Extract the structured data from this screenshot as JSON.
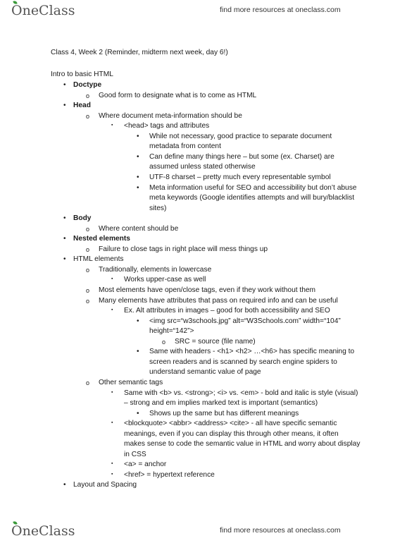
{
  "header": {
    "logo_text": "OneClass",
    "tagline": "find more resources at oneclass.com"
  },
  "footer": {
    "logo_text": "OneClass",
    "tagline": "find more resources at oneclass.com"
  },
  "document": {
    "title": "Class 4, Week 2 (Reminder, midterm next week, day 6!)",
    "section": "Intro to basic HTML",
    "lines": [
      {
        "level": 1,
        "bold": true,
        "text": "Doctype"
      },
      {
        "level": 2,
        "text": "Good form to designate what is to come as HTML"
      },
      {
        "level": 1,
        "bold": true,
        "text": "Head"
      },
      {
        "level": 2,
        "text": "Where document meta-information should be"
      },
      {
        "level": 3,
        "text": "<head> tags and attributes"
      },
      {
        "level": 4,
        "text": "While not necessary, good practice to separate document"
      },
      {
        "level": 4,
        "cont": true,
        "text": "metadata from content"
      },
      {
        "level": 4,
        "text": "Can define many things here – but some (ex. Charset) are"
      },
      {
        "level": 4,
        "cont": true,
        "text": "assumed unless stated otherwise"
      },
      {
        "level": 4,
        "text": "UTF-8 charset – pretty much every representable symbol"
      },
      {
        "level": 4,
        "text": "Meta information useful for SEO and accessibility but don’t abuse"
      },
      {
        "level": 4,
        "cont": true,
        "text": "meta keywords (Google identifies attempts and will bury/blacklist"
      },
      {
        "level": 4,
        "cont": true,
        "text": "sites)"
      },
      {
        "level": 1,
        "bold": true,
        "text": "Body"
      },
      {
        "level": 2,
        "text": "Where content should be"
      },
      {
        "level": 1,
        "bold": true,
        "text": "Nested elements"
      },
      {
        "level": 2,
        "text": "Failure to close tags in right place will mess things up"
      },
      {
        "level": 1,
        "text": "HTML elements"
      },
      {
        "level": 2,
        "text": "Traditionally, elements in lowercase"
      },
      {
        "level": 3,
        "text": "Works upper-case as well"
      },
      {
        "level": 2,
        "text": "Most elements have open/close tags, even if they work without them"
      },
      {
        "level": 2,
        "text": "Many elements have attributes that pass on required info and can be useful"
      },
      {
        "level": 3,
        "text": "Ex. Alt attributes in images – good for both accessibility and SEO"
      },
      {
        "level": 4,
        "text": "<img src=“w3schools.jpg” alt=“W3Schools.com” width=“104”"
      },
      {
        "level": 4,
        "cont": true,
        "text": "height=“142”>"
      },
      {
        "level": 5,
        "text": "SRC = source (file name)"
      },
      {
        "level": 4,
        "text": "Same with headers - <h1> <h2> …<h6> has specific meaning to"
      },
      {
        "level": 4,
        "cont": true,
        "text": "screen readers and is scanned by search engine spiders to"
      },
      {
        "level": 4,
        "cont": true,
        "text": "understand semantic value of page"
      },
      {
        "level": 2,
        "text": "Other semantic tags"
      },
      {
        "level": 3,
        "text": "Same with <b> vs. <strong>; <i> vs. <em> - bold and italic is style (visual)"
      },
      {
        "level": 3,
        "cont": true,
        "text": "– strong and em implies marked text is important (semantics)"
      },
      {
        "level": 4,
        "text": "Shows up the same but has different meanings"
      },
      {
        "level": 3,
        "text": "<blockquote> <abbr> <address> <cite> - all have specific semantic"
      },
      {
        "level": 3,
        "cont": true,
        "text": "meanings, even if you can display this through other means, it often"
      },
      {
        "level": 3,
        "cont": true,
        "text": "makes sense to code the semantic value in HTML and worry about display"
      },
      {
        "level": 3,
        "cont": true,
        "text": "in CSS"
      },
      {
        "level": 3,
        "text": "<a> = anchor"
      },
      {
        "level": 3,
        "text": "<href> = hypertext reference"
      },
      {
        "level": 1,
        "text": "Layout and Spacing"
      }
    ]
  }
}
